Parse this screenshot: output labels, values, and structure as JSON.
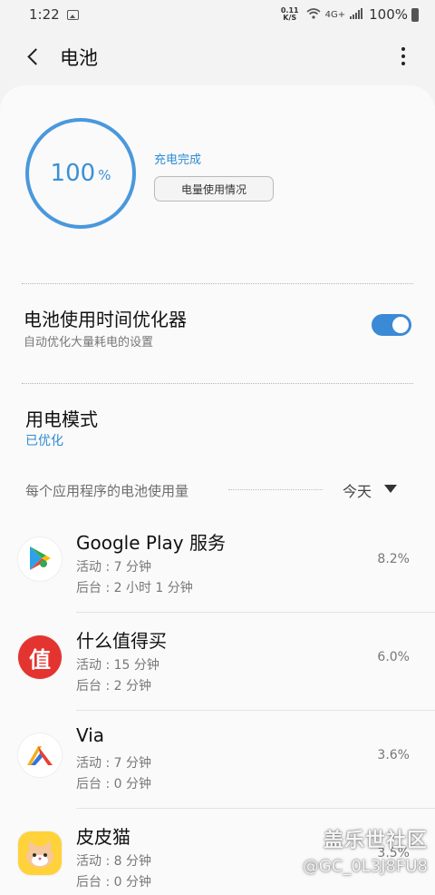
{
  "status_bar": {
    "time": "1:22",
    "net_speed_value": "0.11",
    "net_speed_unit": "K/S",
    "network_type": "4G+",
    "battery_percent": "100%"
  },
  "header": {
    "title": "电池"
  },
  "battery": {
    "level": 100,
    "percent_value": "100",
    "percent_unit": "%",
    "status": "充电完成",
    "usage_button": "电量使用情况",
    "ring_color": "#4a98dd"
  },
  "optimizer": {
    "title": "电池使用时间优化器",
    "subtitle": "自动优化大量耗电的设置",
    "enabled": true
  },
  "power_mode": {
    "title": "用电模式",
    "value": "已优化"
  },
  "app_usage": {
    "section_label": "每个应用程序的电池使用量",
    "period": "今天",
    "apps": [
      {
        "name": "Google Play 服务",
        "active": "活动 : 7 分钟",
        "background": "后台 : 2 小时 1 分钟",
        "percent": "8.2%",
        "icon": "google-play-services-icon"
      },
      {
        "name": "什么值得买",
        "active": "活动 : 15 分钟",
        "background": "后台 : 2 分钟",
        "percent": "6.0%",
        "icon": "smzdm-icon",
        "icon_glyph": "值"
      },
      {
        "name": "Via",
        "active": "活动 : 7 分钟",
        "background": "后台 : 0 分钟",
        "percent": "3.6%",
        "icon": "via-browser-icon"
      },
      {
        "name": "皮皮猫",
        "active": "活动 : 8 分钟",
        "background": "后台 : 0 分钟",
        "percent": "3.5%",
        "icon": "pipimao-cat-icon"
      }
    ]
  },
  "watermark": {
    "name": "盖乐世社区",
    "user": "@GC_0L3J8FU8"
  },
  "colors": {
    "accent": "#3b8ad6",
    "background": "#f3f3f3",
    "card": "#fafafa"
  }
}
